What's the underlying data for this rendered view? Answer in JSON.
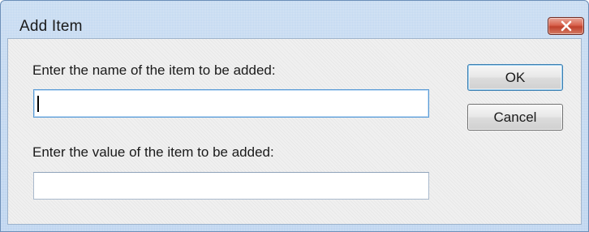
{
  "dialog": {
    "title": "Add Item",
    "close_icon": "close-x-icon"
  },
  "form": {
    "name_label": "Enter the name of the item to be added:",
    "name_value": "",
    "value_label": "Enter the value of the item to be added:",
    "value_value": ""
  },
  "buttons": {
    "ok_label": "OK",
    "cancel_label": "Cancel"
  },
  "colors": {
    "title_bar": "#b8d1ee",
    "close_button": "#c0412c",
    "focus_border": "#5a9bd6"
  }
}
